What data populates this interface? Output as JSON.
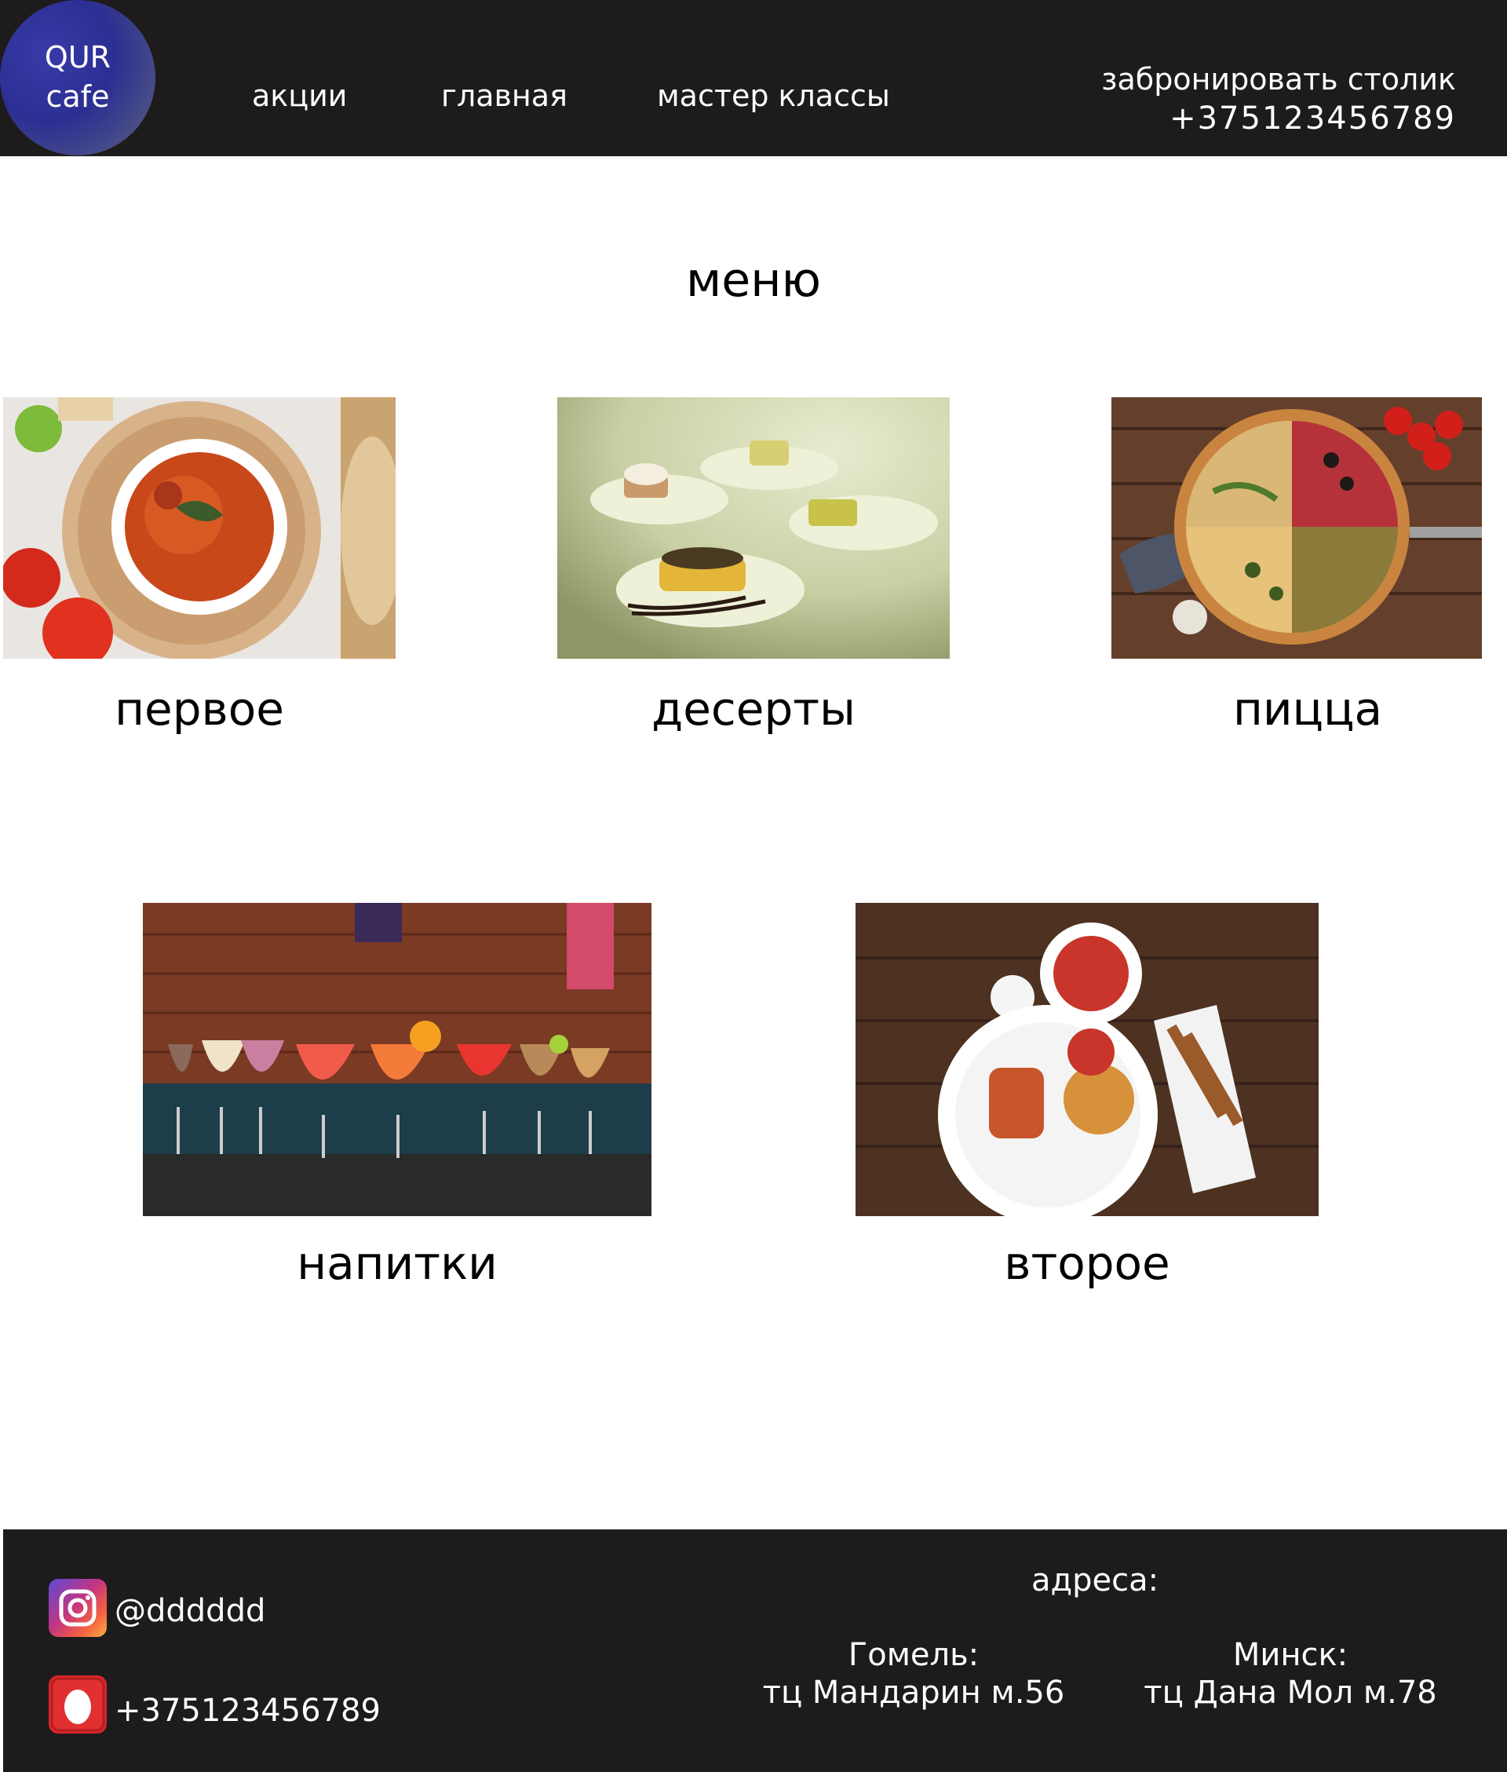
{
  "header": {
    "logo_line1": "QUR",
    "logo_line2": "cafe",
    "nav": [
      "акции",
      "главная",
      "мастер классы"
    ],
    "booking_label": "забронировать столик",
    "booking_phone": "+375123456789"
  },
  "main": {
    "title": "меню",
    "categories": [
      {
        "label": "первое"
      },
      {
        "label": "десерты"
      },
      {
        "label": "пицца"
      },
      {
        "label": "напитки"
      },
      {
        "label": "второе"
      }
    ]
  },
  "footer": {
    "instagram_handle": "@dddddd",
    "phone": "+375123456789",
    "addresses_title": "адреса:",
    "addresses": [
      {
        "city": "Гомель:",
        "place": "тц Мандарин м.56"
      },
      {
        "city": "Минск:",
        "place": "тц Дана Мол м.78"
      }
    ]
  },
  "colors": {
    "header_bg": "#1e1b1c",
    "footer_bg": "#1e1b1c",
    "logo_blue": "#2b2f92"
  },
  "icons": [
    "instagram-icon",
    "phone-app-icon"
  ]
}
